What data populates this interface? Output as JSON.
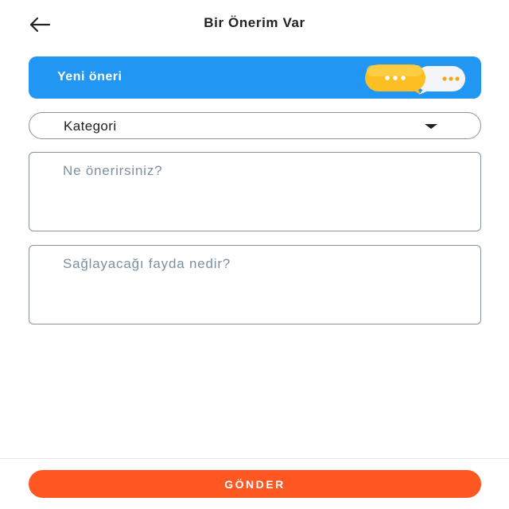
{
  "header": {
    "title": "Bir Önerim Var",
    "back_icon": "arrow-left-icon"
  },
  "banner": {
    "title": "Yeni öneri",
    "illustration": "chat-bubbles-icon",
    "background_color": "#2196f3"
  },
  "form": {
    "category": {
      "value": "Kategori",
      "icon": "caret-down-icon"
    },
    "suggestion": {
      "value": "",
      "placeholder": "Ne önerirsiniz?"
    },
    "benefit": {
      "value": "",
      "placeholder": "Sağlayacağı fayda nedir?"
    }
  },
  "footer": {
    "submit_label": "GÖNDER",
    "submit_color": "#ff5722"
  }
}
